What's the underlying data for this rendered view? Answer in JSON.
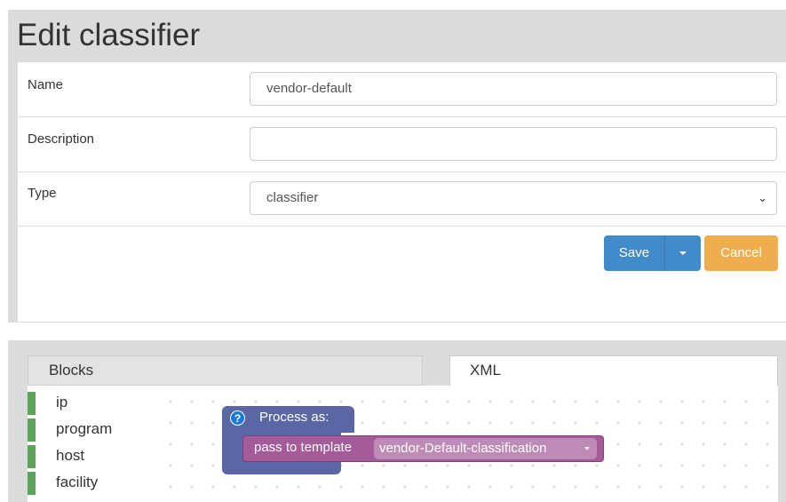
{
  "page": {
    "title": "Edit classifier"
  },
  "form": {
    "name": {
      "label": "Name",
      "value": "vendor-default"
    },
    "description": {
      "label": "Description",
      "value": ""
    },
    "type": {
      "label": "Type",
      "value": "classifier"
    }
  },
  "actions": {
    "save_label": "Save",
    "cancel_label": "Cancel"
  },
  "editor": {
    "tabs": {
      "blocks": "Blocks",
      "xml": "XML"
    },
    "toolbox": [
      "ip",
      "program",
      "host",
      "facility"
    ],
    "block": {
      "help": "?",
      "header": "Process as:",
      "statement": "pass to template",
      "template_value": "vendor-Default-classification"
    }
  },
  "colors": {
    "primary": "#428bca",
    "warning": "#f0ad4e",
    "block_outer": "#5b67a5",
    "block_inner": "#a55b99",
    "toolbox_bar": "#5ba55b"
  }
}
